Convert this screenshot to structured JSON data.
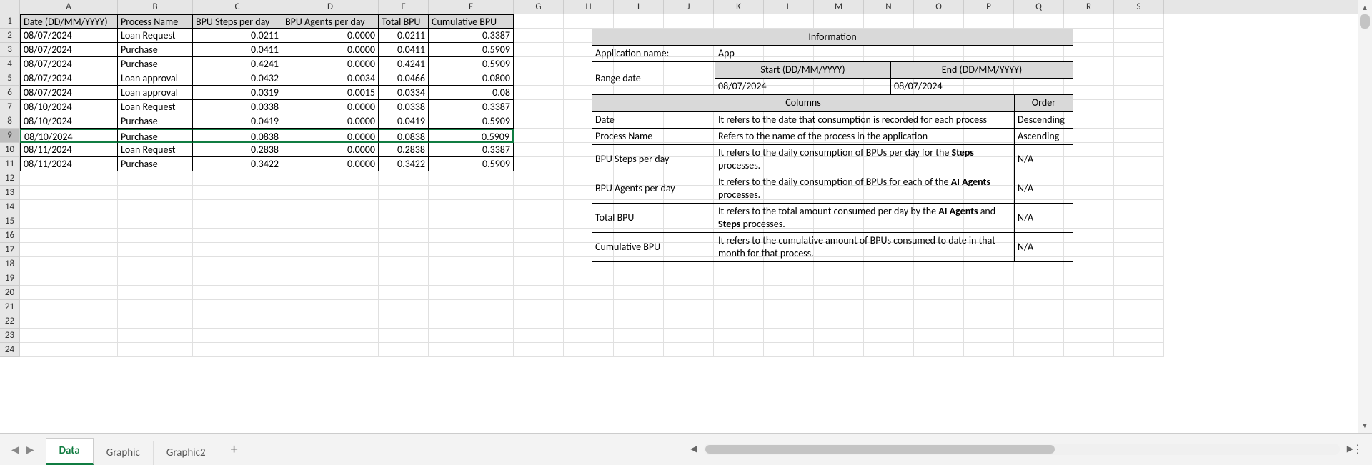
{
  "columns": [
    "A",
    "B",
    "C",
    "D",
    "E",
    "F",
    "G",
    "H",
    "I",
    "J",
    "K",
    "L",
    "M",
    "N",
    "O",
    "P",
    "Q",
    "R",
    "S"
  ],
  "rowCount": 24,
  "dataHeaders": {
    "A": "Date (DD/MM/YYYY)",
    "B": "Process Name",
    "C": "BPU Steps per day",
    "D": "BPU Agents per day",
    "E": "Total BPU",
    "F": "Cumulative BPU"
  },
  "dataRows": [
    {
      "A": "08/07/2024",
      "B": "Loan Request",
      "C": "0.0211",
      "D": "0.0000",
      "E": "0.0211",
      "F": "0.3387"
    },
    {
      "A": "08/07/2024",
      "B": "Purchase",
      "C": "0.0411",
      "D": "0.0000",
      "E": "0.0411",
      "F": "0.5909"
    },
    {
      "A": "08/07/2024",
      "B": "Purchase",
      "C": "0.4241",
      "D": "0.0000",
      "E": "0.4241",
      "F": "0.5909"
    },
    {
      "A": "08/07/2024",
      "B": "Loan approval",
      "C": "0.0432",
      "D": "0.0034",
      "E": "0.0466",
      "F": "0.0800"
    },
    {
      "A": "08/07/2024",
      "B": "Loan approval",
      "C": "0.0319",
      "D": "0.0015",
      "E": "0.0334",
      "F": "0.08"
    },
    {
      "A": "08/10/2024",
      "B": "Loan Request",
      "C": "0.0338",
      "D": "0.0000",
      "E": "0.0338",
      "F": "0.3387"
    },
    {
      "A": "08/10/2024",
      "B": "Purchase",
      "C": "0.0419",
      "D": "0.0000",
      "E": "0.0419",
      "F": "0.5909"
    },
    {
      "A": "08/10/2024",
      "B": "Purchase",
      "C": "0.0838",
      "D": "0.0000",
      "E": "0.0838",
      "F": "0.5909"
    },
    {
      "A": "08/11/2024",
      "B": "Loan Request",
      "C": "0.2838",
      "D": "0.0000",
      "E": "0.2838",
      "F": "0.3387"
    },
    {
      "A": "08/11/2024",
      "B": "Purchase",
      "C": "0.3422",
      "D": "0.0000",
      "E": "0.3422",
      "F": "0.5909"
    }
  ],
  "info": {
    "title": "Information",
    "appNameLabel": "Application name:",
    "appNameValue": "App",
    "rangeLabel": "Range date",
    "startLabel": "Start (DD/MM/YYYY)",
    "endLabel": "End (DD/MM/YYYY)",
    "startValue": "08/07/2024",
    "endValue": "08/07/2024",
    "columnsLabel": "Columns",
    "orderLabel": "Order",
    "cols": [
      {
        "name": "Date",
        "desc": "It refers to the date that consumption is recorded for each process",
        "order": "Descending"
      },
      {
        "name": "Process Name",
        "desc": "Refers to the name of the process in the application",
        "order": "Ascending"
      },
      {
        "name": "BPU Steps per day",
        "desc_html": "It refers to the daily consumption of BPUs per day for the <b>Steps</b> processes.",
        "order": "N/A"
      },
      {
        "name": "BPU Agents per day",
        "desc_html": "It refers to the daily consumption of BPUs for each of the <b>AI Agents</b> processes.",
        "order": "N/A"
      },
      {
        "name": "Total BPU",
        "desc_html": "It refers to the total amount consumed per day by the <b>AI Agents</b> and <b>Steps</b> processes.",
        "order": "N/A"
      },
      {
        "name": "Cumulative BPU",
        "desc": "It refers to the cumulative amount of BPUs consumed to date in that month for that process.",
        "order": "N/A"
      }
    ]
  },
  "tabs": [
    "Data",
    "Graphic",
    "Graphic2"
  ],
  "activeTab": 0,
  "selectedRow": 9
}
